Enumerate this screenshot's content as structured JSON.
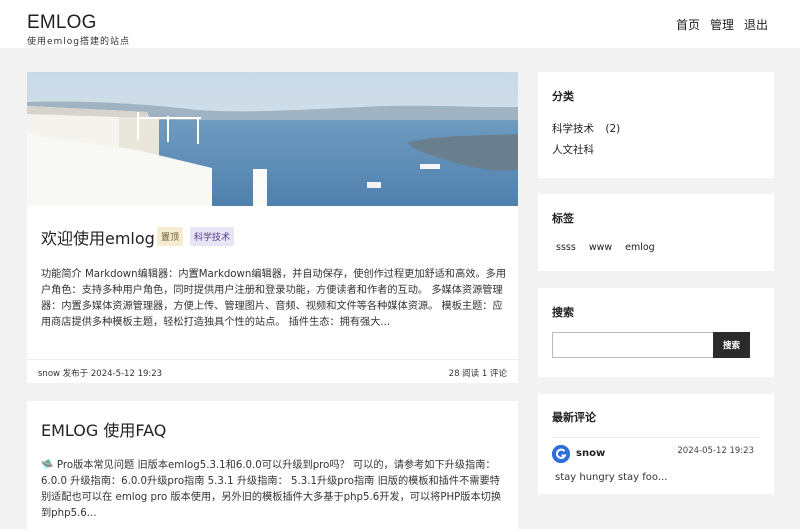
{
  "header": {
    "logo": "EMLOG",
    "tagline": "使用emlog搭建的站点",
    "nav": [
      "首页",
      "管理",
      "退出"
    ]
  },
  "posts": [
    {
      "title": "欢迎使用emlog",
      "badges": [
        "置顶",
        "科学技术"
      ],
      "excerpt": "功能简介 Markdown编辑器：内置Markdown编辑器，并自动保存，使创作过程更加舒适和高效。多用户角色：支持多种用户角色，同时提供用户注册和登录功能，方便读者和作者的互动。 多媒体资源管理器：内置多媒体资源管理器，方便上传、管理图片、音频、视频和文件等各种媒体资源。 模板主题：应用商店提供多种模板主题，轻松打造独具个性的站点。 插件生态：拥有强大...",
      "meta_left": "snow 发布于  2024-5-12 19:23",
      "meta_right": "28 阅读 1 评论"
    },
    {
      "title": "EMLOG 使用FAQ",
      "excerpt": "🛸 Pro版本常见问题 旧版本emlog5.3.1和6.0.0可以升级到pro吗？ 可以的，请参考如下升级指南： 6.0.0 升级指南：6.0.0升级pro指南 5.3.1 升级指南： 5.3.1升级pro指南 旧版的模板和插件不需要特别适配也可以在 emlog pro 版本使用，另外旧的模板插件大多基于php5.6开发，可以将PHP版本切换到php5.6..."
    }
  ],
  "sidebar": {
    "categories": {
      "title": "分类",
      "items": [
        {
          "label": "科学技术",
          "count": "(2)"
        },
        {
          "label": "人文社科",
          "count": ""
        }
      ]
    },
    "tags": {
      "title": "标签",
      "items": [
        "ssss",
        "www",
        "emlog"
      ]
    },
    "search": {
      "title": "搜索",
      "button": "搜索",
      "value": ""
    },
    "comments": {
      "title": "最新评论",
      "author": "snow",
      "date": "2024-05-12 19:23",
      "text": "stay hungry stay foo..."
    }
  }
}
